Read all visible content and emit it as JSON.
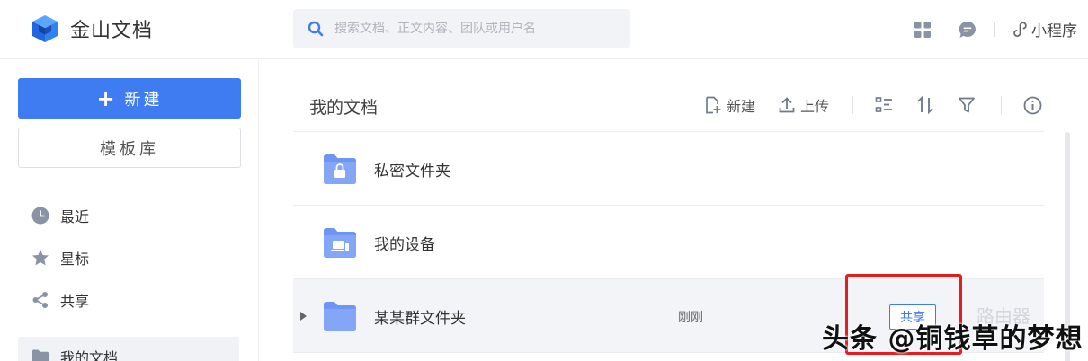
{
  "header": {
    "app_name": "金山文档",
    "search_placeholder": "搜索文档、正文内容、团队或用户名",
    "mini_program": "小程序"
  },
  "sidebar": {
    "new_label": "新建",
    "template_label": "模板库",
    "items": [
      {
        "label": "最近",
        "icon": "clock-icon"
      },
      {
        "label": "星标",
        "icon": "star-icon"
      },
      {
        "label": "共享",
        "icon": "share-icon"
      },
      {
        "label": "我的文档",
        "icon": "folder-icon",
        "active": true
      }
    ]
  },
  "main": {
    "breadcrumb": "我的文档",
    "toolbar": {
      "new_label": "新建",
      "upload_label": "上传"
    },
    "rows": [
      {
        "name": "私密文件夹",
        "icon": "lock-folder-icon",
        "time": "",
        "share": ""
      },
      {
        "name": "我的设备",
        "icon": "device-folder-icon",
        "time": "",
        "share": ""
      },
      {
        "name": "某某群文件夹",
        "icon": "folder-icon",
        "time": "刚刚",
        "share": "共享"
      }
    ]
  },
  "watermark": {
    "text": "头条 @铜钱草的梦想",
    "faint": "路由器"
  },
  "colors": {
    "accent": "#3f7cf2",
    "folder": "#6f95f4",
    "highlight_box": "#e81c1c"
  }
}
